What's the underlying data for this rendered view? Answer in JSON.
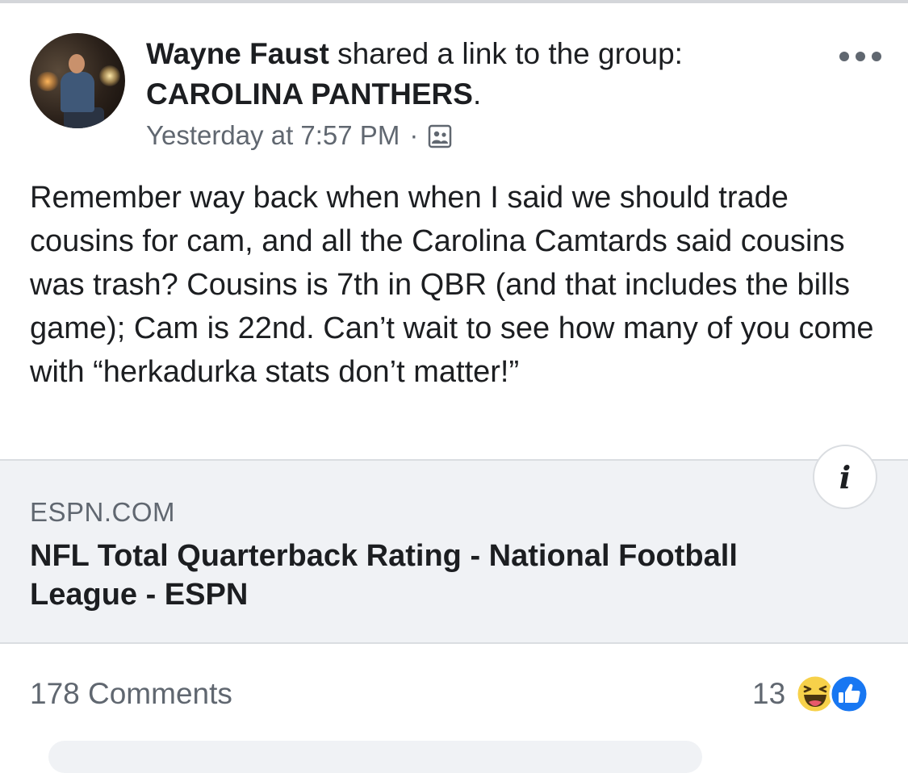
{
  "post": {
    "author": "Wayne Faust",
    "action": "shared a link to the group:",
    "group": "CAROLINA PANTHERS",
    "group_suffix": ".",
    "timestamp": "Yesterday at 7:57 PM",
    "separator": "·",
    "privacy_icon": "group-icon",
    "body": "Remember way back when when I said we should trade cousins for cam, and all the Carolina Camtards said cousins was trash? Cousins is 7th in QBR (and that includes the bills game); Cam is 22nd. Can’t wait to see how many of you come with “herkadurka stats don’t matter!”"
  },
  "link": {
    "domain": "ESPN.COM",
    "title": "NFL Total Quarterback Rating - National Football League - ESPN",
    "info_label": "i"
  },
  "footer": {
    "comments": "178 Comments",
    "reaction_count": "13",
    "reaction_icons": [
      "haha-icon",
      "like-icon"
    ]
  },
  "colors": {
    "text": "#1c1e21",
    "secondary": "#606770",
    "card_bg": "#f0f2f5",
    "like_blue": "#1877f2",
    "haha_yellow": "#f7d14a"
  }
}
